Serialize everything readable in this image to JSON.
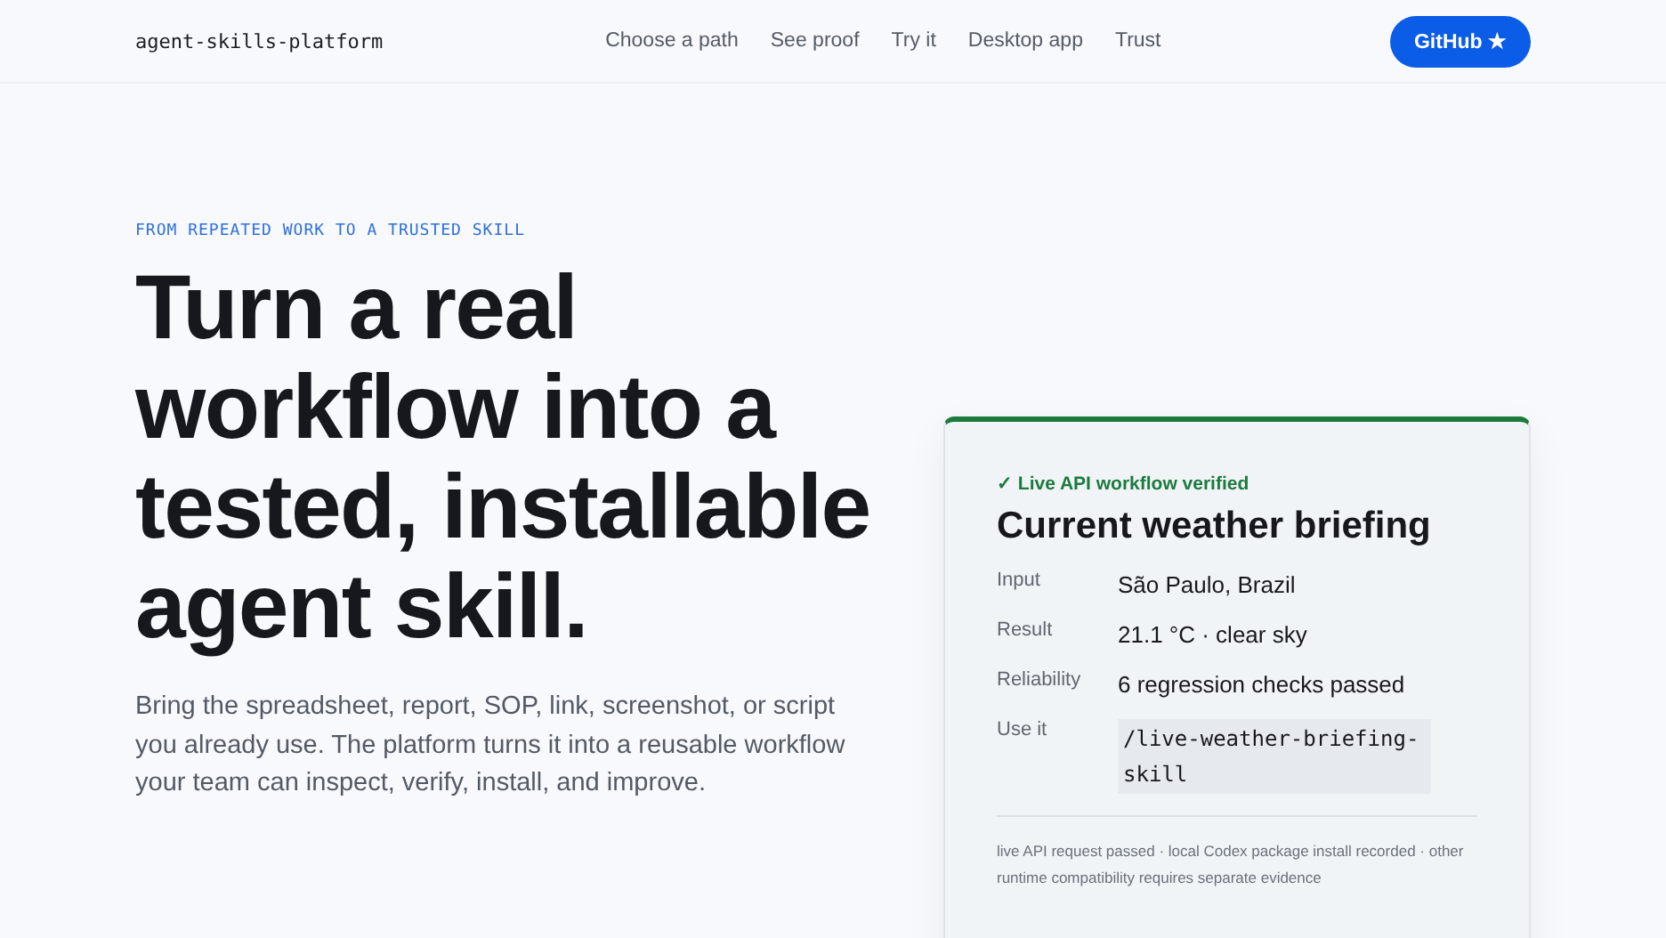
{
  "brand": "agent-skills-platform",
  "nav": [
    "Choose a path",
    "See proof",
    "Try it",
    "Desktop app",
    "Trust"
  ],
  "github_button": "GitHub ★",
  "hero": {
    "eyebrow": "FROM REPEATED WORK TO A TRUSTED SKILL",
    "title": "Turn a real workflow into a tested, installable agent skill.",
    "lead": "Bring the spreadsheet, report, SOP, link, screenshot, or script you already use.  The platform turns it into a reusable workflow your team can inspect, verify, install, and improve."
  },
  "card": {
    "status": "✓ Live API workflow verified",
    "title": "Current weather briefing",
    "rows": [
      {
        "kind": "text",
        "label": "Input",
        "value": "São Paulo, Brazil"
      },
      {
        "kind": "text",
        "label": "Result",
        "value": "21.1 °C · clear sky"
      },
      {
        "kind": "text",
        "label": "Reliability",
        "value": "6 regression checks passed"
      },
      {
        "kind": "code",
        "label": "Use it",
        "value": "/live-weather-briefing-skill"
      }
    ],
    "note": "live API request passed · local Codex package install recorded · other runtime compatibility requires separate evidence"
  }
}
